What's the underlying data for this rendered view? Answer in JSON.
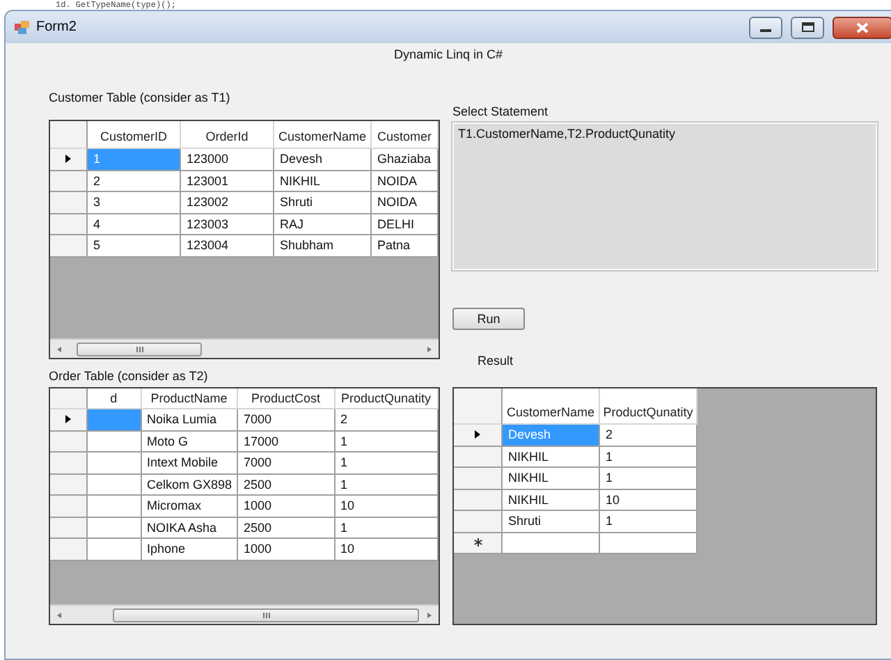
{
  "background_code": "1d. GetTypeName(type)();",
  "window": {
    "title": "Form2"
  },
  "heading": "Dynamic Linq in C#",
  "customer_table": {
    "label": "Customer Table (consider as T1)",
    "columns": [
      "CustomerID",
      "OrderId",
      "CustomerName",
      "Customer"
    ],
    "rows": [
      {
        "current": true,
        "cells": [
          {
            "text": "1",
            "selected": true
          },
          {
            "text": "123000",
            "selected": false
          },
          {
            "text": "Devesh",
            "selected": false
          },
          {
            "text": "Ghaziaba",
            "selected": false
          }
        ]
      },
      {
        "current": false,
        "cells": [
          {
            "text": "2",
            "selected": false
          },
          {
            "text": "123001",
            "selected": false
          },
          {
            "text": "NIKHIL",
            "selected": false
          },
          {
            "text": "NOIDA",
            "selected": false
          }
        ]
      },
      {
        "current": false,
        "cells": [
          {
            "text": "3",
            "selected": false
          },
          {
            "text": "123002",
            "selected": false
          },
          {
            "text": "Shruti",
            "selected": false
          },
          {
            "text": "NOIDA",
            "selected": false
          }
        ]
      },
      {
        "current": false,
        "cells": [
          {
            "text": "4",
            "selected": false
          },
          {
            "text": "123003",
            "selected": false
          },
          {
            "text": "RAJ",
            "selected": false
          },
          {
            "text": "DELHI",
            "selected": false
          }
        ]
      },
      {
        "current": false,
        "cells": [
          {
            "text": "5",
            "selected": false
          },
          {
            "text": "123004",
            "selected": false
          },
          {
            "text": "Shubham",
            "selected": false
          },
          {
            "text": "Patna",
            "selected": false
          }
        ]
      }
    ],
    "new_row": false
  },
  "select_statement": {
    "label": "Select Statement",
    "value": "T1.CustomerName,T2.ProductQunatity"
  },
  "run_button": "Run",
  "result_label": "Result",
  "order_table": {
    "label": "Order Table (consider as T2)",
    "columns": [
      "d",
      "ProductName",
      "ProductCost",
      "ProductQunatity"
    ],
    "rows": [
      {
        "current": true,
        "cells": [
          {
            "text": "",
            "selected": true
          },
          {
            "text": "Noika Lumia",
            "selected": false
          },
          {
            "text": "7000",
            "selected": false
          },
          {
            "text": "2",
            "selected": false
          }
        ]
      },
      {
        "current": false,
        "cells": [
          {
            "text": "",
            "selected": false
          },
          {
            "text": "Moto G",
            "selected": false
          },
          {
            "text": "17000",
            "selected": false
          },
          {
            "text": "1",
            "selected": false
          }
        ]
      },
      {
        "current": false,
        "cells": [
          {
            "text": "",
            "selected": false
          },
          {
            "text": "Intext Mobile",
            "selected": false
          },
          {
            "text": "7000",
            "selected": false
          },
          {
            "text": "1",
            "selected": false
          }
        ]
      },
      {
        "current": false,
        "cells": [
          {
            "text": "",
            "selected": false
          },
          {
            "text": "Celkom GX898",
            "selected": false
          },
          {
            "text": "2500",
            "selected": false
          },
          {
            "text": "1",
            "selected": false
          }
        ]
      },
      {
        "current": false,
        "cells": [
          {
            "text": "",
            "selected": false
          },
          {
            "text": "Micromax",
            "selected": false
          },
          {
            "text": "1000",
            "selected": false
          },
          {
            "text": "10",
            "selected": false
          }
        ]
      },
      {
        "current": false,
        "cells": [
          {
            "text": "",
            "selected": false
          },
          {
            "text": "NOIKA Asha",
            "selected": false
          },
          {
            "text": "2500",
            "selected": false
          },
          {
            "text": "1",
            "selected": false
          }
        ]
      },
      {
        "current": false,
        "cells": [
          {
            "text": "",
            "selected": false
          },
          {
            "text": "Iphone",
            "selected": false
          },
          {
            "text": "1000",
            "selected": false
          },
          {
            "text": "10",
            "selected": false
          }
        ]
      }
    ],
    "new_row": false
  },
  "result_table": {
    "columns": [
      "CustomerName",
      "ProductQunatity"
    ],
    "rows": [
      {
        "current": true,
        "cells": [
          {
            "text": "Devesh",
            "selected": true
          },
          {
            "text": "2",
            "selected": false
          }
        ]
      },
      {
        "current": false,
        "cells": [
          {
            "text": "NIKHIL",
            "selected": false
          },
          {
            "text": "1",
            "selected": false
          }
        ]
      },
      {
        "current": false,
        "cells": [
          {
            "text": "NIKHIL",
            "selected": false
          },
          {
            "text": "1",
            "selected": false
          }
        ]
      },
      {
        "current": false,
        "cells": [
          {
            "text": "NIKHIL",
            "selected": false
          },
          {
            "text": "10",
            "selected": false
          }
        ]
      },
      {
        "current": false,
        "cells": [
          {
            "text": "Shruti",
            "selected": false
          },
          {
            "text": "1",
            "selected": false
          }
        ]
      }
    ],
    "new_row": true
  }
}
